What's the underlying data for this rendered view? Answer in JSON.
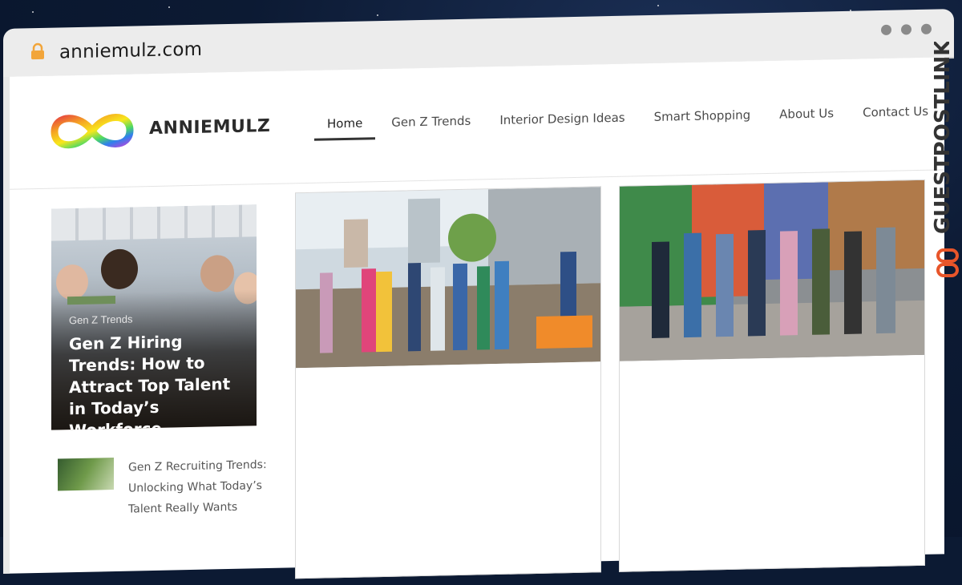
{
  "browser": {
    "url": "anniemulz.com"
  },
  "site": {
    "logo_text": "ANNIEMULZ",
    "nav": [
      {
        "label": "Home",
        "active": true
      },
      {
        "label": "Gen Z Trends"
      },
      {
        "label": "Interior Design Ideas"
      },
      {
        "label": "Smart Shopping"
      },
      {
        "label": "About Us"
      },
      {
        "label": "Contact Us"
      }
    ]
  },
  "featured": {
    "category": "Gen Z Trends",
    "title": "Gen Z Hiring Trends: How to Attract Top Talent in Today’s Workforce"
  },
  "side_posts": [
    {
      "title": "Gen Z Recruiting Trends: Unlocking What Today’s Talent Really Wants"
    }
  ],
  "watermark": {
    "text": "GUESTPOSTLINKS"
  },
  "colors": {
    "accent_nav_underline": "#333333",
    "watermark_orange": "#e8552a"
  }
}
